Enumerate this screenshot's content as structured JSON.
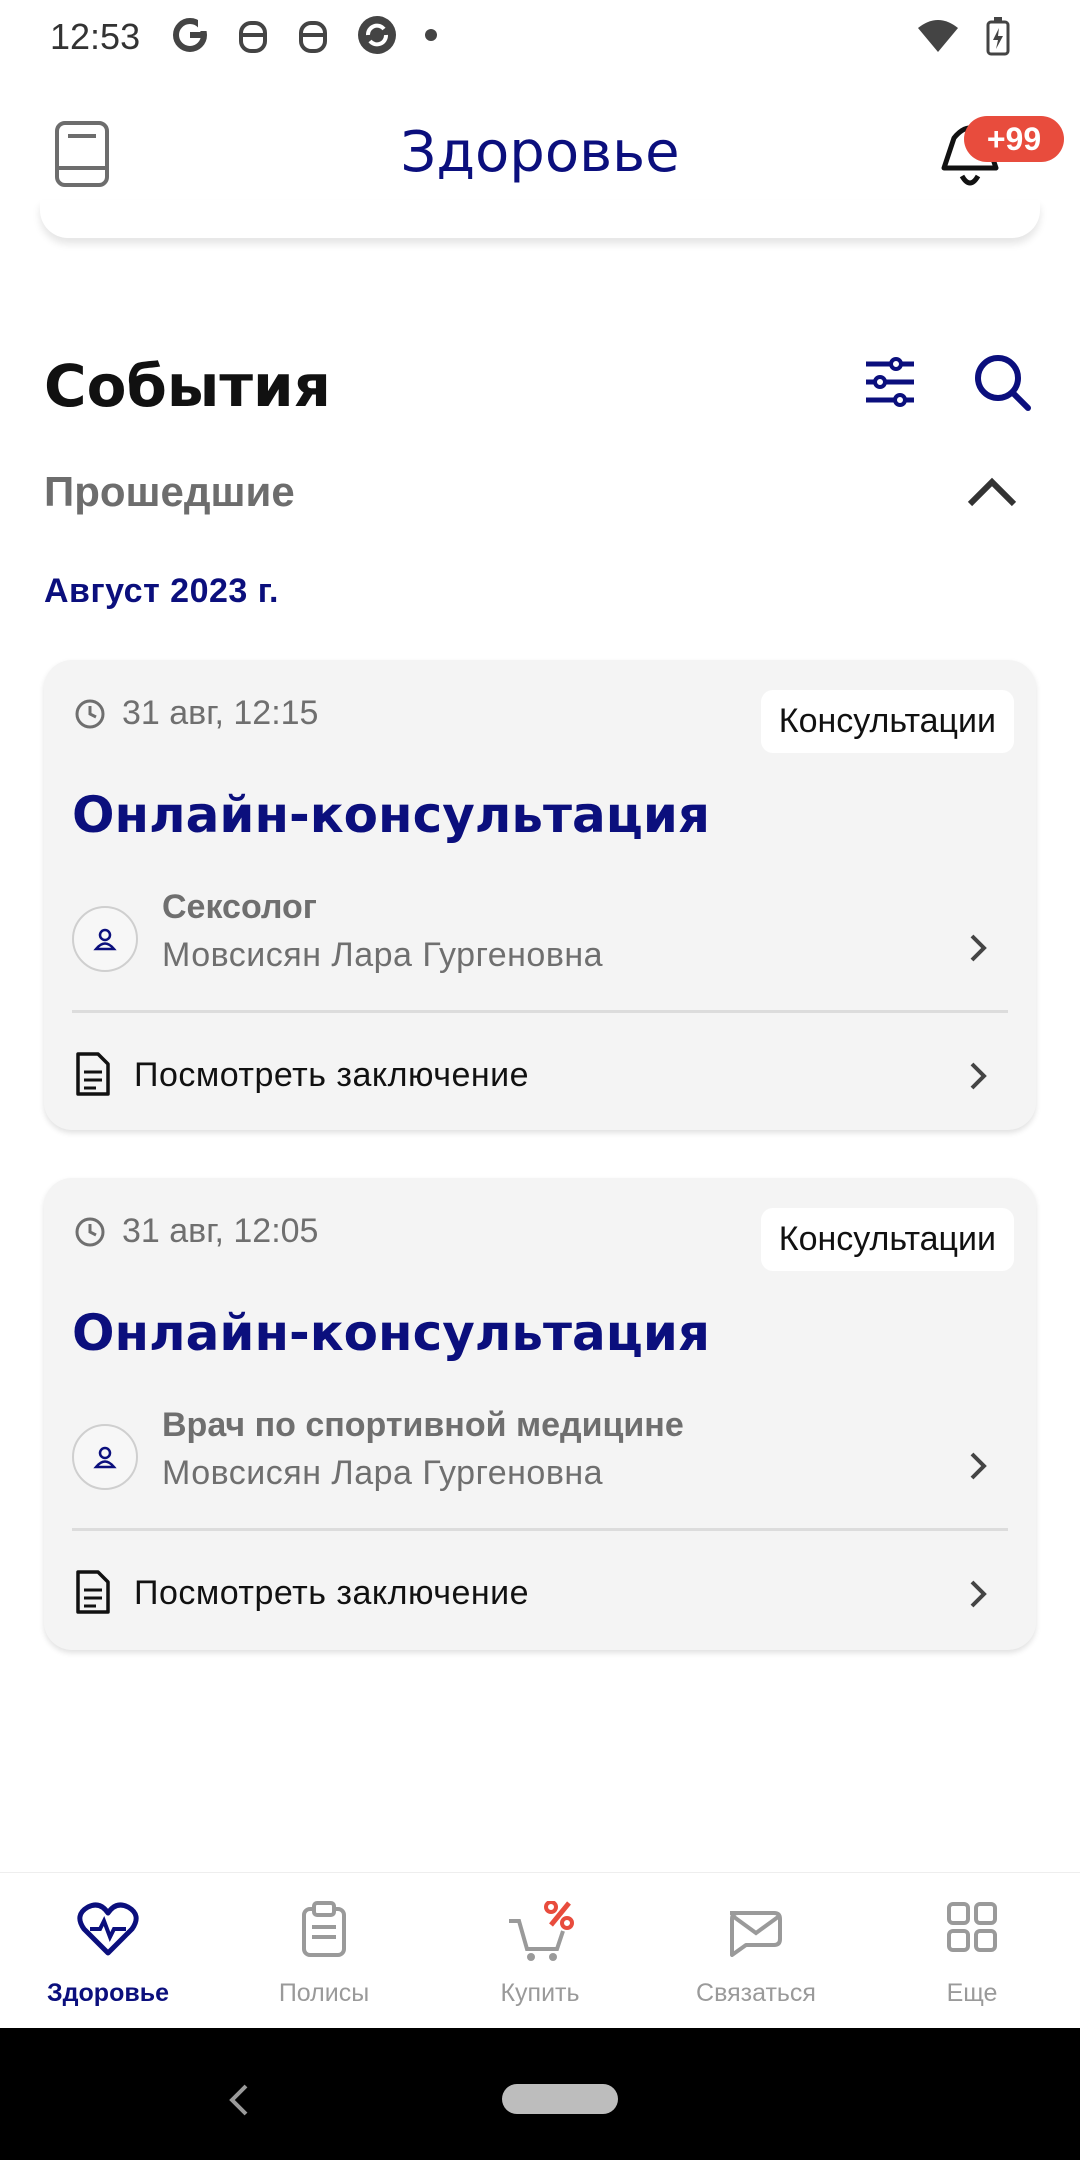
{
  "status_bar": {
    "time": "12:53",
    "icons": [
      "google-icon",
      "bug-icon",
      "bug-icon",
      "sync-icon",
      "dot-icon"
    ],
    "right_icons": [
      "wifi-icon",
      "battery-icon"
    ]
  },
  "app_bar": {
    "title": "Здоровье",
    "notifications_badge": "+99"
  },
  "events": {
    "title": "События",
    "filter_label": "Прошедшие",
    "month_label": "Август 2023 г.",
    "items": [
      {
        "datetime": "31 авг, 12:15",
        "tag": "Консультации",
        "title": "Онлайн-консультация",
        "specialty": "Сексолог",
        "doctor": "Мовсисян Лара Гургеновна",
        "conclusion_label": "Посмотреть заключение"
      },
      {
        "datetime": "31 авг, 12:05",
        "tag": "Консультации",
        "title": "Онлайн-консультация",
        "specialty": "Врач по спортивной медицине",
        "doctor": "Мовсисян Лара Гургеновна",
        "conclusion_label": "Посмотреть заключение"
      }
    ]
  },
  "bottom_nav": {
    "items": [
      {
        "label": "Здоровье",
        "icon": "heart-pulse-icon",
        "active": true
      },
      {
        "label": "Полисы",
        "icon": "clipboard-icon",
        "active": false
      },
      {
        "label": "Купить",
        "icon": "cart-percent-icon",
        "active": false
      },
      {
        "label": "Связаться",
        "icon": "message-icon",
        "active": false
      },
      {
        "label": "Еще",
        "icon": "grid-icon",
        "active": false
      }
    ]
  },
  "colors": {
    "brand": "#0b0f7d",
    "badge": "#e84c3d",
    "card_bg": "#f4f4f4",
    "muted_text": "#6f6f6f"
  }
}
